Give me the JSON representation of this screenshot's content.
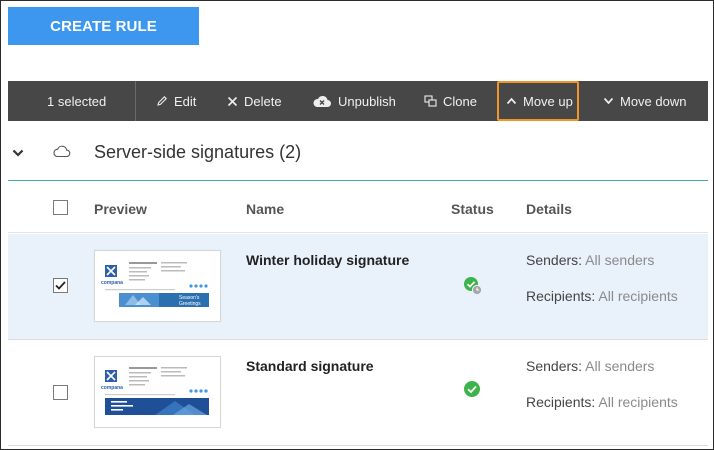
{
  "create_button": "CREATE RULE",
  "toolbar": {
    "selected": "1 selected",
    "edit": "Edit",
    "delete": "Delete",
    "unpublish": "Unpublish",
    "clone": "Clone",
    "move_up": "Move up",
    "move_down": "Move down",
    "highlight_color": "#f0952a"
  },
  "group": {
    "title": "Server-side signatures (2)"
  },
  "columns": {
    "preview": "Preview",
    "name": "Name",
    "status": "Status",
    "details": "Details"
  },
  "rows": [
    {
      "name": "Winter holiday signature",
      "checked": true,
      "status": "published-pending",
      "senders_label": "Senders:",
      "senders_value": "All senders",
      "recipients_label": "Recipients:",
      "recipients_value": "All recipients",
      "preview_brand": "compana",
      "preview_banner": "Season's Greetings"
    },
    {
      "name": "Standard signature",
      "checked": false,
      "status": "published",
      "senders_label": "Senders:",
      "senders_value": "All senders",
      "recipients_label": "Recipients:",
      "recipients_value": "All recipients",
      "preview_brand": "compana",
      "preview_banner": ""
    }
  ],
  "colors": {
    "accent": "#3d97ee",
    "toolbar_bg": "#474747",
    "selected_row": "#e9f1fb",
    "status_green": "#3cb44b"
  }
}
